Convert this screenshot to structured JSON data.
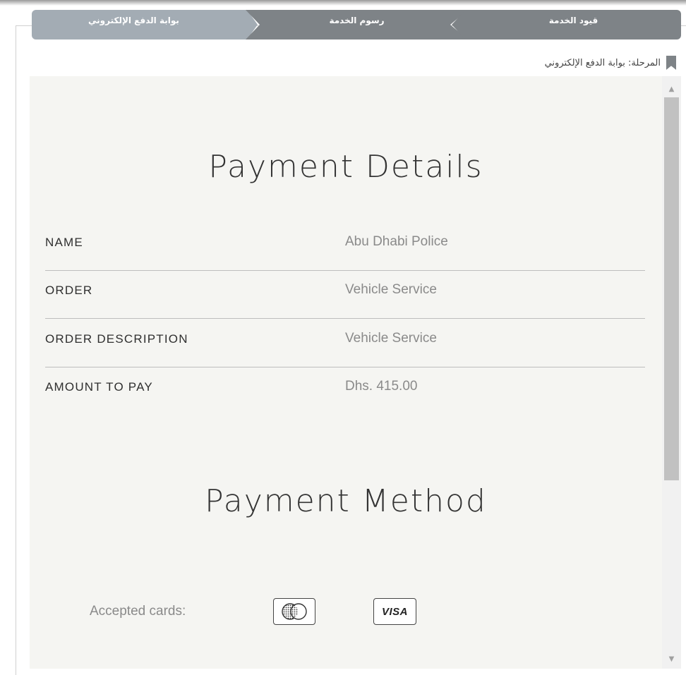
{
  "steps": [
    {
      "label": "قيود الخدمة"
    },
    {
      "label": "رسوم الخدمة"
    },
    {
      "label": "بوابة الدفع الإلكتروني"
    }
  ],
  "stage": {
    "text": "المرحلة: بوابة الدفع الإلكتروني",
    "icon": "bookmark-icon"
  },
  "payment_details": {
    "title": "Payment Details",
    "rows": [
      {
        "label": "NAME",
        "value": "Abu Dhabi Police"
      },
      {
        "label": "ORDER",
        "value": "Vehicle Service"
      },
      {
        "label": "ORDER DESCRIPTION",
        "value": "Vehicle Service"
      },
      {
        "label": "AMOUNT TO PAY",
        "value": "Dhs. 415.00"
      }
    ]
  },
  "payment_method": {
    "title": "Payment Method",
    "accepted_label": "Accepted cards:",
    "cards": [
      {
        "name": "mastercard",
        "icon": "mastercard-icon"
      },
      {
        "name": "visa",
        "text": "VISA",
        "icon": "visa-icon"
      }
    ]
  },
  "colors": {
    "step_active": "#a3acb4",
    "step_inactive": "#7e8387",
    "panel_bg": "#f5f5f2"
  }
}
